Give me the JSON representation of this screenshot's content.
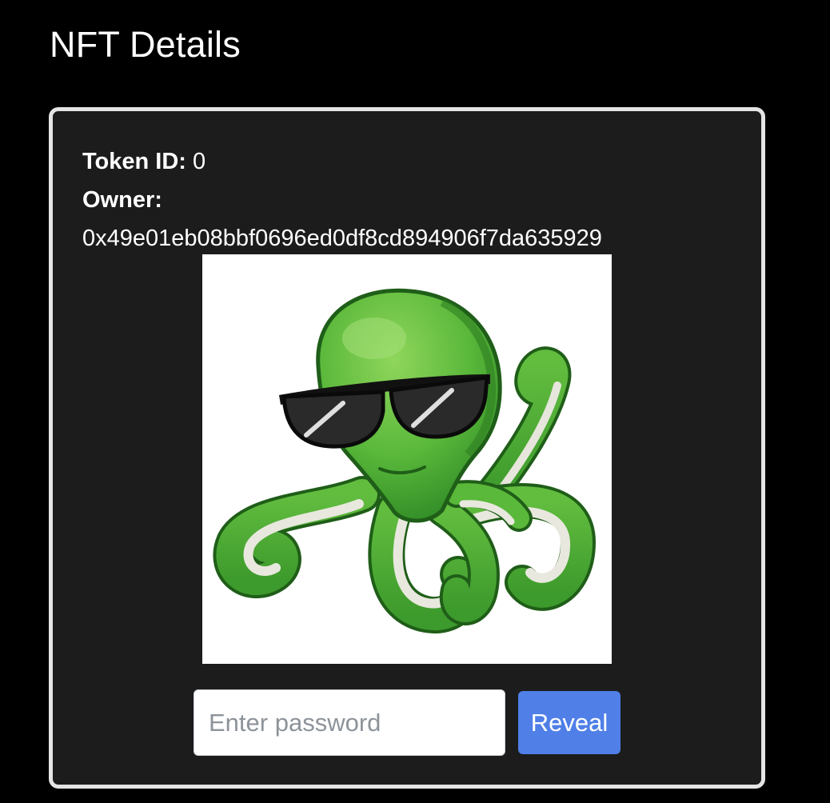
{
  "page": {
    "title": "NFT Details"
  },
  "nft": {
    "token_id_label": "Token ID:",
    "token_id": "0",
    "owner_label": "Owner:",
    "owner_address": "0x49e01eb08bbf0696ed0df8cd894906f7da635929",
    "image_subject": "green-octopus-with-sunglasses"
  },
  "reveal_form": {
    "password_placeholder": "Enter password",
    "password_value": "",
    "reveal_label": "Reveal"
  },
  "colors": {
    "page_background": "#000000",
    "card_background": "#1c1c1c",
    "card_border": "#e4e4e4",
    "button_background": "#4f7fe7",
    "octopus_green": "#5ab83a"
  }
}
